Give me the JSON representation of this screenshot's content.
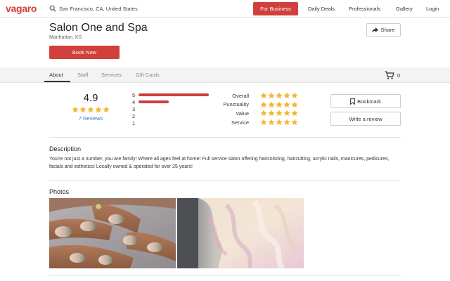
{
  "header": {
    "logo": "vagaro",
    "search_value": "San Francisco, CA, United States",
    "for_business": "For Business",
    "nav": [
      "Daily Deals",
      "Professionals",
      "Gallery",
      "Login"
    ]
  },
  "salon": {
    "name": "Salon One and Spa",
    "location": "Manhattan, KS",
    "book_now": "Book Now",
    "share": "Share"
  },
  "tabs": [
    {
      "label": "About",
      "active": true
    },
    {
      "label": "Staff",
      "active": false
    },
    {
      "label": "Services",
      "active": false
    },
    {
      "label": "Gift Cards",
      "active": false
    }
  ],
  "cart": {
    "count": "0",
    "icon": "cart-icon"
  },
  "ratings": {
    "score": "4.9",
    "stars": 5,
    "reviews_text": "7 Reviews",
    "distribution": [
      {
        "label": "5",
        "fraction": 1.0
      },
      {
        "label": "4",
        "fraction": 0.43
      },
      {
        "label": "3",
        "fraction": 0
      },
      {
        "label": "2",
        "fraction": 0
      },
      {
        "label": "1",
        "fraction": 0
      }
    ],
    "categories": [
      {
        "label": "Overall",
        "stars": 5
      },
      {
        "label": "Punctuality",
        "stars": 5
      },
      {
        "label": "Value",
        "stars": 5
      },
      {
        "label": "Service",
        "stars": 5
      }
    ]
  },
  "actions": {
    "bookmark": "Bookmark",
    "write_review": "Write a review"
  },
  "description": {
    "title": "Description",
    "text": "You're not just a number, you are family! Where all ages feel at home! Full service salon offering haircoloring, haircutting, acrylic nails, manicures, pedicures, facials and esthetics! Locally owned & operated for over 25 years!"
  },
  "photos": {
    "title": "Photos"
  },
  "colors": {
    "brand": "#d1403c",
    "star": "#f2b632",
    "link": "#3b7ac9"
  }
}
